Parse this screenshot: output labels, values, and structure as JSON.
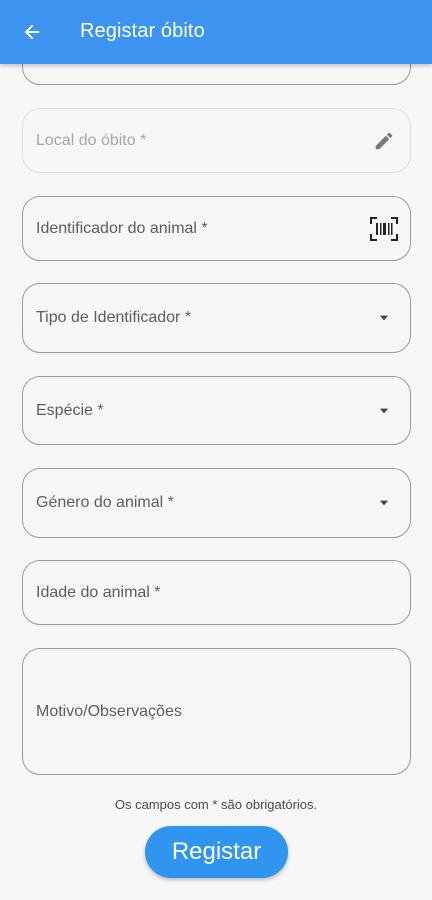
{
  "appbar": {
    "title": "Registar óbito",
    "back_icon": "arrow-back-icon",
    "color": "#3c93f0"
  },
  "form": {
    "fields": [
      {
        "label": "",
        "icon": ""
      },
      {
        "label": "Local do óbito *",
        "icon": "edit-pencil-icon",
        "state": "disabled"
      },
      {
        "label": "Identificador do animal *",
        "icon": "barcode-scan-icon"
      },
      {
        "label": "Tipo de Identificador *",
        "icon": "dropdown-arrow-icon"
      },
      {
        "label": "Espécie *",
        "icon": "dropdown-arrow-icon"
      },
      {
        "label": "Género do animal *",
        "icon": "dropdown-arrow-icon"
      },
      {
        "label": "Idade do animal *",
        "icon": ""
      },
      {
        "label": "Motivo/Observações",
        "icon": ""
      }
    ],
    "footnote": "Os campos com * são obrigatórios.",
    "submit_label": "Registar",
    "accent_color": "#2f95ef"
  }
}
